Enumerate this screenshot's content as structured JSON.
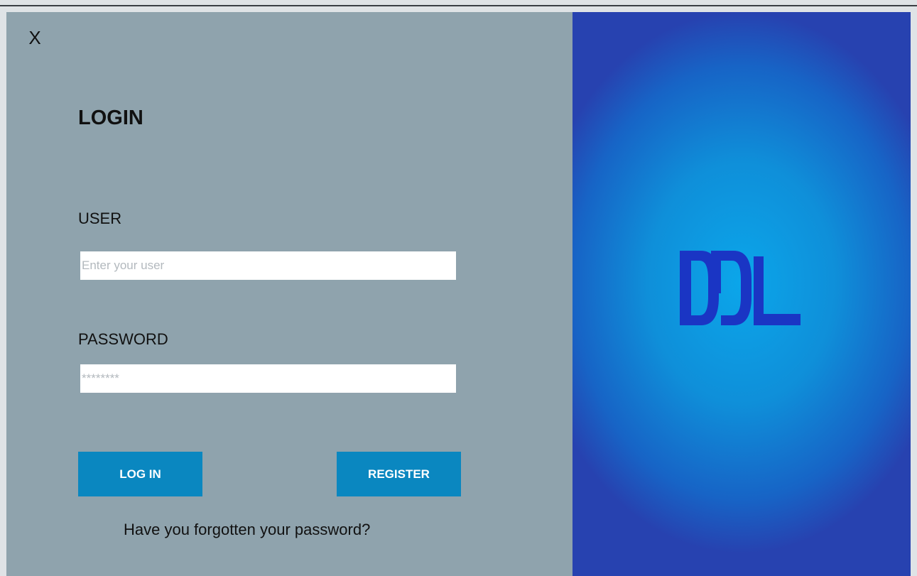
{
  "window": {
    "topbar_text": ""
  },
  "login": {
    "close_label": "X",
    "title": "LOGIN",
    "user_label": "USER",
    "user_placeholder": "Enter your user",
    "password_label": "PASSWORD",
    "password_placeholder": "********",
    "login_button": "LOG IN",
    "register_button": "REGISTER",
    "forgot_link": "Have you forgotten your password?"
  },
  "brand": {
    "logo_text": "DDL"
  },
  "colors": {
    "left_bg": "#8fa3ad",
    "button_bg": "#0a87c0",
    "logo": "#1a35c4",
    "brand_bg": "#0f8fd9"
  }
}
